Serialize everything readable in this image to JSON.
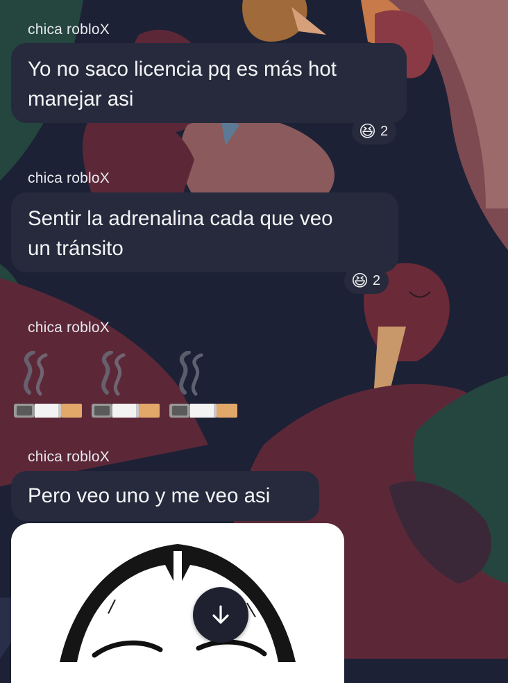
{
  "messages": [
    {
      "sender": "chica robloX",
      "lines": [
        "Yo no saco licencia pq es más hot",
        "manejar asi"
      ],
      "reaction": {
        "emoji": "😆",
        "count": "2"
      }
    },
    {
      "sender": "chica robloX",
      "lines": [
        "Sentir la adrenalina cada que veo",
        "un tránsito"
      ],
      "reaction": {
        "emoji": "😆",
        "count": "2"
      }
    },
    {
      "sender": "chica robloX",
      "sticker": [
        "smoking-cigarette",
        "smoking-cigarette",
        "smoking-cigarette"
      ]
    },
    {
      "sender": "chica robloX",
      "lines": [
        "Pero veo uno y me veo asi"
      ],
      "attachment": "photo"
    }
  ],
  "scroll_button": {
    "icon": "arrow-down-icon"
  },
  "colors": {
    "background": "#1d2135",
    "bubble": "#262a3c",
    "text": "#f4f4f6"
  }
}
